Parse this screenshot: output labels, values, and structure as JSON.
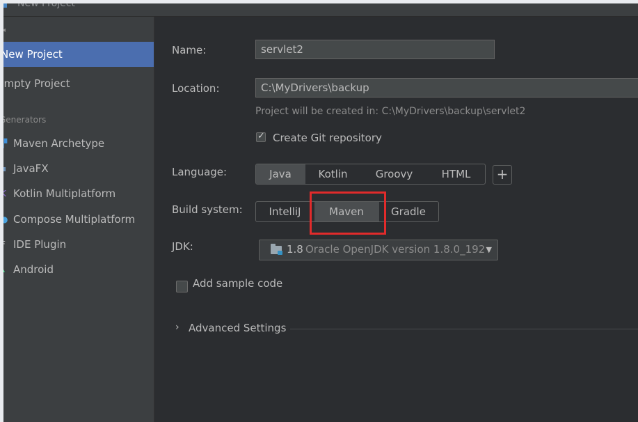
{
  "window": {
    "title": "New Project"
  },
  "sidebar": {
    "items": [
      {
        "label": "New Project",
        "selected": true
      },
      {
        "label": "Empty Project",
        "selected": false
      }
    ],
    "section_label": "Generators",
    "generators": [
      {
        "label": "Maven Archetype",
        "icon": "maven-archetype-icon",
        "color": "#3c8ed8"
      },
      {
        "label": "JavaFX",
        "icon": "javafx-icon",
        "color": "#6a8fb5"
      },
      {
        "label": "Kotlin Multiplatform",
        "icon": "kotlin-icon",
        "color": "#8f6bd6"
      },
      {
        "label": "Compose Multiplatform",
        "icon": "compose-icon",
        "color": "#4aa3df"
      },
      {
        "label": "IDE Plugin",
        "icon": "ide-plugin-icon",
        "color": "#bbbbbb"
      },
      {
        "label": "Android",
        "icon": "android-icon",
        "color": "#3ddc84"
      }
    ]
  },
  "form": {
    "name_label": "Name:",
    "name_value": "servlet2",
    "location_label": "Location:",
    "location_value": "C:\\MyDrivers\\backup",
    "location_hint": "Project will be created in: C:\\MyDrivers\\backup\\servlet2",
    "git_label": "Create Git repository",
    "git_checked": true,
    "language_label": "Language:",
    "languages": [
      "Java",
      "Kotlin",
      "Groovy",
      "HTML"
    ],
    "language_selected": "Java",
    "add_language": "+",
    "build_label": "Build system:",
    "build_systems": [
      "IntelliJ",
      "Maven",
      "Gradle"
    ],
    "build_selected": "Maven",
    "jdk_label": "JDK:",
    "jdk_version": "1.8",
    "jdk_description": "Oracle OpenJDK version 1.8.0_192",
    "sample_code_label": "Add sample code",
    "sample_code_checked": false,
    "advanced_label": "Advanced Settings"
  },
  "colors": {
    "selection": "#4b6eaf",
    "highlight": "#e12b2b"
  }
}
